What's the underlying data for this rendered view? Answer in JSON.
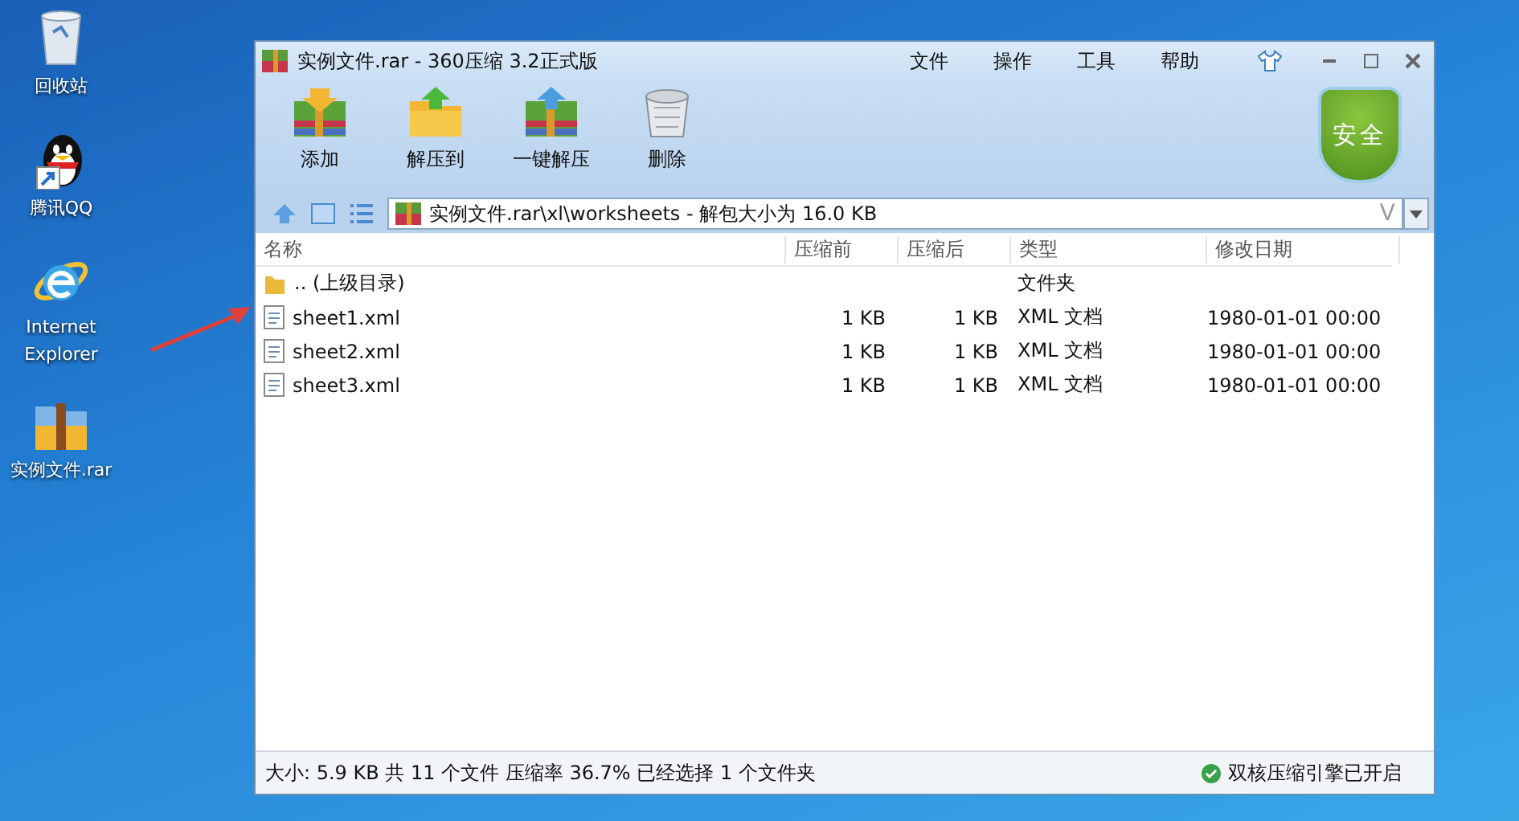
{
  "desktop": {
    "icons": [
      {
        "label": "回收站",
        "kind": "recycle"
      },
      {
        "label": "腾讯QQ",
        "kind": "qq"
      },
      {
        "label": "Internet Explorer",
        "kind": "ie"
      },
      {
        "label": "实例文件.rar",
        "kind": "rar"
      }
    ]
  },
  "window": {
    "title": "实例文件.rar - 360压缩 3.2正式版",
    "menu": [
      "文件",
      "操作",
      "工具",
      "帮助"
    ],
    "toolbar": [
      {
        "label": "添加",
        "kind": "add"
      },
      {
        "label": "解压到",
        "kind": "extract-to"
      },
      {
        "label": "一键解压",
        "kind": "extract"
      },
      {
        "label": "删除",
        "kind": "delete"
      }
    ],
    "badge": "安全",
    "address": "实例文件.rar\\xl\\worksheets - 解包大小为 16.0 KB",
    "address_button": "V",
    "columns": [
      "名称",
      "压缩前",
      "压缩后",
      "类型",
      "修改日期"
    ],
    "rows": [
      {
        "kind": "folder",
        "name": ".. (上级目录)",
        "packed": "",
        "unpacked": "",
        "type": "文件夹",
        "modified": ""
      },
      {
        "kind": "file",
        "name": "sheet1.xml",
        "packed": "1 KB",
        "unpacked": "1 KB",
        "type": "XML 文档",
        "modified": "1980-01-01 00:00"
      },
      {
        "kind": "file",
        "name": "sheet2.xml",
        "packed": "1 KB",
        "unpacked": "1 KB",
        "type": "XML 文档",
        "modified": "1980-01-01 00:00"
      },
      {
        "kind": "file",
        "name": "sheet3.xml",
        "packed": "1 KB",
        "unpacked": "1 KB",
        "type": "XML 文档",
        "modified": "1980-01-01 00:00"
      }
    ],
    "status": "大小: 5.9 KB 共 11 个文件 压缩率 36.7% 已经选择 1 个文件夹",
    "engine_status": "双核压缩引擎已开启"
  }
}
